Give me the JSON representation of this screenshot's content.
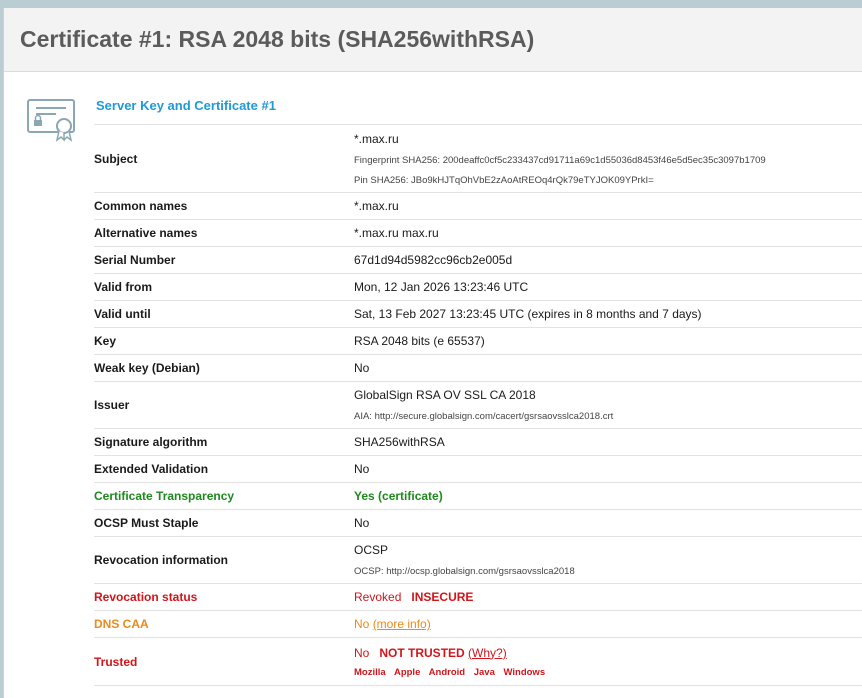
{
  "header": {
    "title": "Certificate #1: RSA 2048 bits (SHA256withRSA)"
  },
  "section": {
    "title": "Server Key and Certificate #1"
  },
  "rows": {
    "subject": {
      "label": "Subject",
      "value": "*.max.ru",
      "fingerprint": "Fingerprint SHA256: 200deaffc0cf5c233437cd91711a69c1d55036d8453f46e5d5ec35c3097b1709",
      "pin": "Pin SHA256: JBo9kHJTqOhVbE2zAoAtREOq4rQk79eTYJOK09YPrkI="
    },
    "common_names": {
      "label": "Common names",
      "value": "*.max.ru"
    },
    "alt_names": {
      "label": "Alternative names",
      "value": "*.max.ru max.ru"
    },
    "serial": {
      "label": "Serial Number",
      "value": "67d1d94d5982cc96cb2e005d"
    },
    "valid_from": {
      "label": "Valid from",
      "value": "Mon, 12 Jan 2026 13:23:46 UTC"
    },
    "valid_until": {
      "label": "Valid until",
      "value": "Sat, 13 Feb 2027 13:23:45 UTC (expires in 8 months and 7 days)"
    },
    "key": {
      "label": "Key",
      "value": "RSA 2048 bits (e 65537)"
    },
    "weak_key": {
      "label": "Weak key (Debian)",
      "value": "No"
    },
    "issuer": {
      "label": "Issuer",
      "value": "GlobalSign RSA OV SSL CA 2018",
      "aia": "AIA: http://secure.globalsign.com/cacert/gsrsaovsslca2018.crt"
    },
    "sig_alg": {
      "label": "Signature algorithm",
      "value": "SHA256withRSA"
    },
    "ev": {
      "label": "Extended Validation",
      "value": "No"
    },
    "ct": {
      "label": "Certificate Transparency",
      "value": "Yes (certificate)"
    },
    "ocsp_staple": {
      "label": "OCSP Must Staple",
      "value": "No"
    },
    "revocation_info": {
      "label": "Revocation information",
      "value": "OCSP",
      "ocsp": "OCSP: http://ocsp.globalsign.com/gsrsaovsslca2018"
    },
    "revocation_status": {
      "label": "Revocation status",
      "value": "Revoked",
      "flag": "INSECURE"
    },
    "dns_caa": {
      "label": "DNS CAA",
      "value": "No",
      "link": "(more info)"
    },
    "trusted": {
      "label": "Trusted",
      "value": "No",
      "flag": "NOT TRUSTED",
      "link": "(Why?)",
      "platforms": [
        "Mozilla",
        "Apple",
        "Android",
        "Java",
        "Windows"
      ]
    }
  },
  "colors": {
    "accent_blue": "#1f9ad6",
    "green": "#1e8a1e",
    "red": "#d0161b",
    "orange": "#ec8a1c"
  }
}
